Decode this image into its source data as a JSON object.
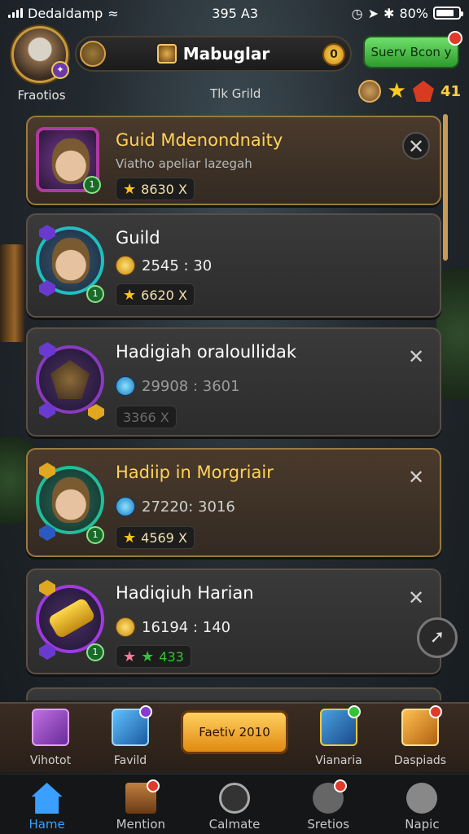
{
  "status_bar": {
    "carrier": "Dedaldamp",
    "time": "395 A3",
    "battery": "80%",
    "battery_level": 0.8
  },
  "header": {
    "profile_name": "Fraotios",
    "title": "Mabuglar",
    "server_button": "Suerv Bcon y",
    "subtitle": "Tlk Grild",
    "currency_value": "41"
  },
  "guild_list": [
    {
      "name": "Guid Mdenondnaity",
      "desc": "Viatho apeliar lazegah",
      "rating": "8630 X",
      "icon": "warrior-portrait-icon"
    },
    {
      "name": "Guild",
      "coins": "2545 : 30",
      "rating": "6620 X",
      "icon": "ranger-portrait-icon"
    },
    {
      "name": "Hadigiah oraloullidak",
      "gems": "29908 : 3601",
      "rating": "3366 X",
      "icon": "dark-emblem-icon"
    },
    {
      "name": "Hadiip in Morgriair",
      "gems": "27220: 3016",
      "rating": "4569 X",
      "icon": "knight-portrait-icon"
    },
    {
      "name": "Hadiqiuh Harian",
      "coins": "16194 : 140",
      "rating": "433",
      "icon": "golden-cannon-icon"
    }
  ],
  "shop": {
    "item1": "Vihotot",
    "item2": "Favild",
    "claim": "Faetiv 2010",
    "item4": "Vianaria",
    "item5": "Daspiads"
  },
  "tabs": {
    "home": "Hame",
    "mentions": "Mention",
    "explore": "Calmate",
    "stories": "Sretios",
    "more": "Napic"
  },
  "colors": {
    "accent": "#3aa0ff",
    "gold": "#ffd25a",
    "server_green": "#4cc44a"
  }
}
